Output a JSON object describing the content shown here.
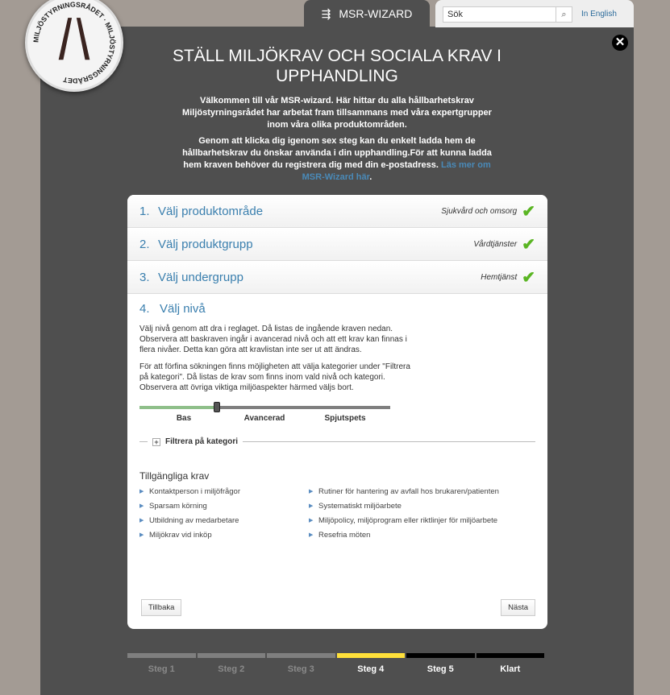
{
  "logo": {
    "text": "MILJÖSTYRNINGSRÅDET"
  },
  "header": {
    "wizard_tab": "MSR-WIZARD",
    "search_placeholder": "Sök",
    "language_link": "In English"
  },
  "title": "STÄLL MILJÖKRAV OCH SOCIALA KRAV I UPPHANDLING",
  "intro1": "Välkommen till vår MSR-wizard. Här hittar du alla hållbarhetskrav Miljöstyrningsrådet har arbetat fram tillsammans med våra expertgrupper inom våra olika produktområden.",
  "intro2": "Genom att klicka dig igenom sex steg kan du enkelt ladda hem de hållbarhetskrav du önskar använda i din upphandling.För att kunna ladda hem kraven behöver du registrera dig med din e-postadress.",
  "intro_link": "Läs mer om MSR-Wizard här",
  "steps": [
    {
      "num": "1.",
      "label": "Välj produktområde",
      "value": "Sjukvård och omsorg"
    },
    {
      "num": "2.",
      "label": "Välj produktgrupp",
      "value": "Vårdtjänster"
    },
    {
      "num": "3.",
      "label": "Välj undergrupp",
      "value": "Hemtjänst"
    }
  ],
  "step4": {
    "num": "4.",
    "label": "Välj nivå",
    "p1": "Välj nivå genom att dra i reglaget. Då listas de ingående kraven nedan. Observera att baskraven ingår i avancerad nivå och att ett krav kan finnas i flera nivåer. Detta kan göra att kravlistan inte ser ut att ändras.",
    "p2": "För att förfina sökningen finns möjligheten att välja kategorier under \"Filtrera på kategori\". Då listas de krav som finns inom vald nivå och kategori. Observera att övriga viktiga miljöaspekter härmed väljs bort.",
    "levels": [
      "Bas",
      "Avancerad",
      "Spjutspets"
    ],
    "selected_level": "Bas",
    "slider_fraction": 0.31,
    "filter_label": "Filtrera på kategori",
    "available_title": "Tillgängliga krav",
    "requirements": [
      "Kontaktperson i miljöfrågor",
      "Rutiner för hantering av avfall hos brukaren/patienten",
      "Sparsam körning",
      "Systematiskt miljöarbete",
      "Utbildning av medarbetare",
      "Miljöpolicy, miljöprogram eller riktlinjer för miljöarbete",
      "Miljökrav vid inköp",
      "Resefria möten"
    ],
    "back": "Tillbaka",
    "next": "Nästa"
  },
  "progress": [
    {
      "label": "Steg 1",
      "state": "done"
    },
    {
      "label": "Steg 2",
      "state": "done"
    },
    {
      "label": "Steg 3",
      "state": "done"
    },
    {
      "label": "Steg 4",
      "state": "current"
    },
    {
      "label": "Steg 5",
      "state": "todo"
    },
    {
      "label": "Klart",
      "state": "todo"
    }
  ],
  "colors": {
    "panel": "#4f4f4f",
    "accent": "#3a7fae",
    "check": "#5ab523",
    "current": "#ffe03a"
  }
}
